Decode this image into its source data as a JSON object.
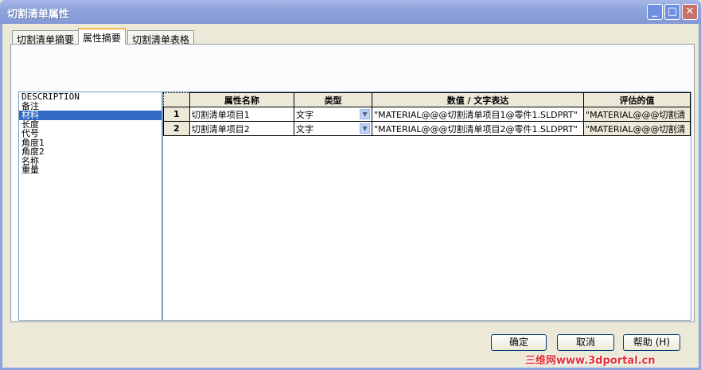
{
  "window": {
    "title": "切割清单属性"
  },
  "tabs": [
    {
      "label": "切割清单摘要"
    },
    {
      "label": "属性摘要"
    },
    {
      "label": "切割清单表格"
    }
  ],
  "property_list": {
    "items": [
      "DESCRIPTION",
      "备注",
      "材料",
      "长度",
      "代号",
      "角度1",
      "角度2",
      "名称",
      "重量"
    ],
    "selected_index": 2
  },
  "grid": {
    "headers": [
      "属性名称",
      "类型",
      "数值 / 文字表达",
      "评估的值"
    ],
    "rows": [
      {
        "num": "1",
        "name": "切割清单项目1",
        "type": "文字",
        "value": "\"MATERIAL@@@切割清单项目1@零件1.SLDPRT\"",
        "evaluated": "\"MATERIAL@@@切割清"
      },
      {
        "num": "2",
        "name": "切割清单项目2",
        "type": "文字",
        "value": "\"MATERIAL@@@切割清单项目2@零件1.SLDPRT\"",
        "evaluated": "\"MATERIAL@@@切割清"
      }
    ]
  },
  "buttons": {
    "ok": "确定",
    "cancel": "取消",
    "help": "帮助 (H)"
  },
  "watermark": "三维网www.3dportal.cn"
}
